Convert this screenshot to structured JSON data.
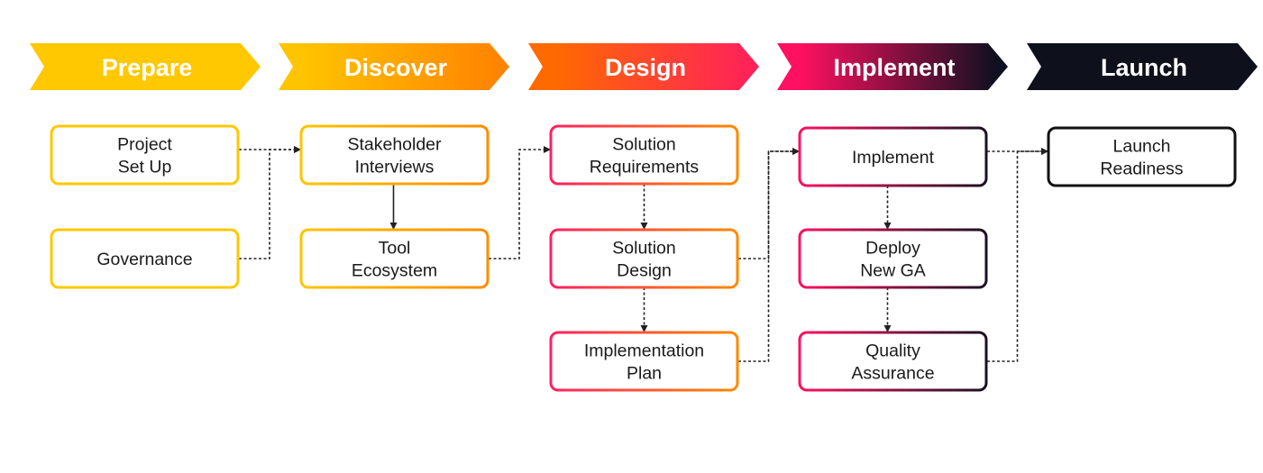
{
  "phases": [
    {
      "label": "Prepare",
      "colors": [
        "#FFC800",
        "#FFC800"
      ]
    },
    {
      "label": "Discover",
      "colors": [
        "#FFC400",
        "#FF8400"
      ]
    },
    {
      "label": "Design",
      "colors": [
        "#FF6A00",
        "#FF2358"
      ]
    },
    {
      "label": "Implement",
      "colors": [
        "#FF1060",
        "#0F1020"
      ]
    },
    {
      "label": "Launch",
      "colors": [
        "#0E111C",
        "#0E111C"
      ]
    }
  ],
  "nodes": [
    {
      "id": "project-set-up",
      "lines": [
        "Project",
        "Set Up"
      ],
      "phase": 0,
      "row": 0
    },
    {
      "id": "governance",
      "lines": [
        "Governance"
      ],
      "phase": 0,
      "row": 1
    },
    {
      "id": "stakeholder-interviews",
      "lines": [
        "Stakeholder",
        "Interviews"
      ],
      "phase": 1,
      "row": 0
    },
    {
      "id": "tool-ecosystem",
      "lines": [
        "Tool",
        "Ecosystem"
      ],
      "phase": 1,
      "row": 1
    },
    {
      "id": "solution-requirements",
      "lines": [
        "Solution",
        "Requirements"
      ],
      "phase": 2,
      "row": 0
    },
    {
      "id": "solution-design",
      "lines": [
        "Solution",
        "Design"
      ],
      "phase": 2,
      "row": 1
    },
    {
      "id": "implementation-plan",
      "lines": [
        "Implementation",
        "Plan"
      ],
      "phase": 2,
      "row": 2
    },
    {
      "id": "implement",
      "lines": [
        "Implement"
      ],
      "phase": 3,
      "row": 0
    },
    {
      "id": "deploy-new-ga",
      "lines": [
        "Deploy",
        "New GA"
      ],
      "phase": 3,
      "row": 1
    },
    {
      "id": "quality-assurance",
      "lines": [
        "Quality",
        "Assurance"
      ],
      "phase": 3,
      "row": 2
    },
    {
      "id": "launch-readiness",
      "lines": [
        "Launch",
        "Readiness"
      ],
      "phase": 4,
      "row": 0
    }
  ],
  "node_border_colors": [
    [
      "#FFC800",
      "#FFC800"
    ],
    [
      "#FFC400",
      "#FF8C00"
    ],
    [
      "#FF2060",
      "#FF8A00"
    ],
    [
      "#FF1060",
      "#1A1020"
    ],
    [
      "#111111",
      "#111111"
    ]
  ],
  "edges": [
    {
      "from": "project-set-up",
      "to": "stakeholder-interviews",
      "style": "dotted"
    },
    {
      "from": "governance",
      "to": "stakeholder-interviews",
      "style": "dotted"
    },
    {
      "from": "stakeholder-interviews",
      "to": "tool-ecosystem",
      "style": "solid"
    },
    {
      "from": "tool-ecosystem",
      "to": "solution-requirements",
      "style": "dotted"
    },
    {
      "from": "solution-requirements",
      "to": "solution-design",
      "style": "dotted"
    },
    {
      "from": "solution-design",
      "to": "implementation-plan",
      "style": "dotted"
    },
    {
      "from": "solution-design",
      "to": "implement",
      "style": "dotted"
    },
    {
      "from": "implementation-plan",
      "to": "implement",
      "style": "dotted"
    },
    {
      "from": "implement",
      "to": "deploy-new-ga",
      "style": "dotted"
    },
    {
      "from": "deploy-new-ga",
      "to": "quality-assurance",
      "style": "dotted"
    },
    {
      "from": "implement",
      "to": "launch-readiness",
      "style": "dotted"
    },
    {
      "from": "quality-assurance",
      "to": "launch-readiness",
      "style": "dotted"
    }
  ]
}
